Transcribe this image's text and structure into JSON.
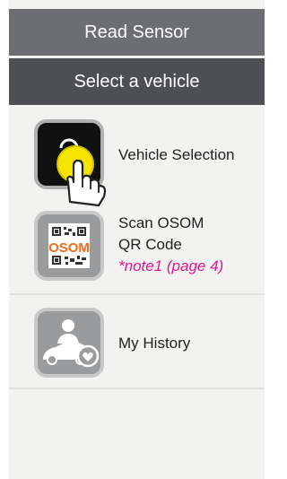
{
  "header": {
    "title": "Read Sensor",
    "subtitle": "Select a vehicle"
  },
  "menu": {
    "items": [
      {
        "label": "Vehicle Selection",
        "icon": "lock-hand-icon"
      },
      {
        "label_line1": "Scan OSOM",
        "label_line2": "QR Code",
        "note": "*note1 (page 4)",
        "icon": "osom-qr-icon",
        "icon_text": "OSOM"
      },
      {
        "label": "My History",
        "icon": "history-icon"
      }
    ]
  },
  "colors": {
    "header_top": "#6d6e71",
    "header_sub": "#4e4f52",
    "panel": "#f2f2f0",
    "note": "#e0188f",
    "accent_yellow": "#f5e400",
    "osom_orange": "#f26a1b"
  }
}
